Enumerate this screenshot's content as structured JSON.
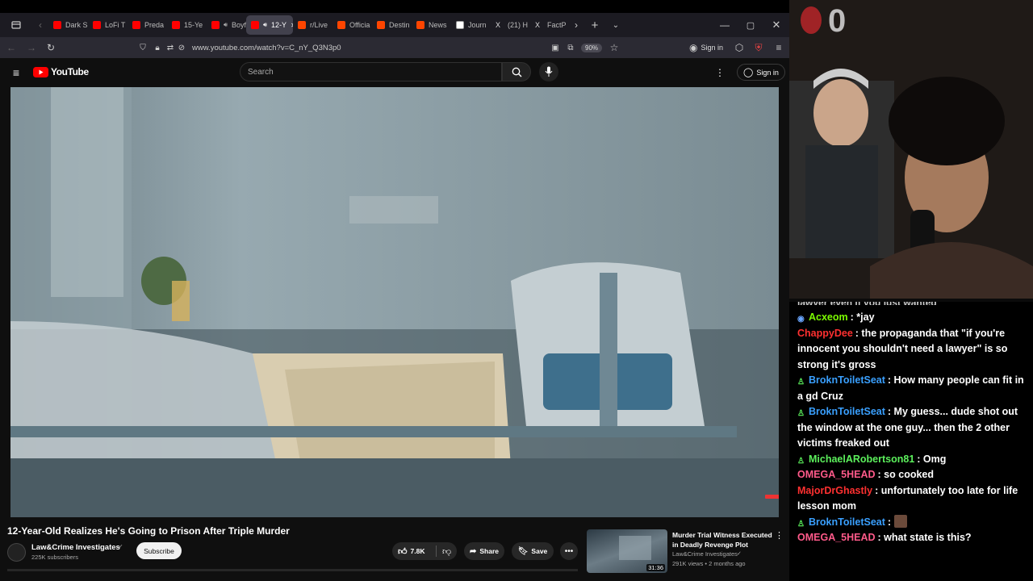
{
  "tabs": [
    {
      "label": "Dark S",
      "color": "#ff0000"
    },
    {
      "label": "LoFi T",
      "color": "#ff0000"
    },
    {
      "label": "Preda",
      "color": "#ff0000"
    },
    {
      "label": "15-Ye",
      "color": "#ff0000"
    },
    {
      "label": "Boyfri",
      "color": "#ff0000"
    },
    {
      "label": "12-Y",
      "color": "#ff0000"
    },
    {
      "label": "r/Live",
      "color": "#ff4500"
    },
    {
      "label": "Officia",
      "color": "#ff4500"
    },
    {
      "label": "Destin",
      "color": "#ff4500"
    },
    {
      "label": "News",
      "color": "#ff4500"
    },
    {
      "label": "Journ",
      "color": "#ffffff"
    },
    {
      "label": "(21) H",
      "color": "#000000"
    },
    {
      "label": "FactP",
      "color": "#000000"
    }
  ],
  "browser": {
    "url": "www.youtube.com/watch?v=C_nY_Q3N3p0",
    "zoom": "90%",
    "signin": "Sign in"
  },
  "youtube": {
    "logo": "YouTube",
    "search_placeholder": "Search",
    "signin": "Sign in"
  },
  "video": {
    "title": "12-Year-Old Realizes He's Going to Prison After Triple Murder",
    "channel": "Law&Crime Investigates",
    "subscribers": "225K subscribers",
    "subscribe": "Subscribe",
    "likes": "7.8K",
    "share": "Share",
    "save": "Save"
  },
  "recommended": {
    "title_line1": "Murder Trial Witness Executed",
    "title_line2": "in Deadly Revenge Plot",
    "channel": "Law&Crime Investigates",
    "meta": "291K views • 2 months ago",
    "duration": "31:36"
  },
  "stream": {
    "overlay_number": "0"
  },
  "chat": [
    {
      "user": "Acxeom",
      "color": "#7cfc00",
      "text": ": *jay",
      "badge": "eye-icon"
    },
    {
      "user": "ChappyDee",
      "color": "#ff3030",
      "text": ": the propaganda that \"if you're innocent you shouldn't need a lawyer\" is so strong it's gross",
      "badge": ""
    },
    {
      "user": "BroknToiletSeat",
      "color": "#3aa0ff",
      "text": ": How many people can fit in a gd Cruz",
      "badge": "user-icon"
    },
    {
      "user": "BroknToiletSeat",
      "color": "#3aa0ff",
      "text": ": My guess... dude shot out the window at the one guy... then the 2 other victims freaked out",
      "badge": "user-icon"
    },
    {
      "user": "MichaelARobertson81",
      "color": "#5cf05c",
      "text": ": Omg",
      "badge": "user-icon"
    },
    {
      "user": "OMEGA_5HEAD",
      "color": "#ff5a8a",
      "text": ": so cooked",
      "badge": ""
    },
    {
      "user": "MajorDrGhastly",
      "color": "#ff3030",
      "text": ": unfortunately too late for life lesson mom",
      "badge": ""
    },
    {
      "user": "BroknToiletSeat",
      "color": "#3aa0ff",
      "text": ":",
      "badge": "user-icon"
    },
    {
      "user": "OMEGA_5HEAD",
      "color": "#ff5a8a",
      "text": ": what state is this?",
      "badge": ""
    }
  ],
  "chat_partial_top": "lawyer even if you just wanted"
}
